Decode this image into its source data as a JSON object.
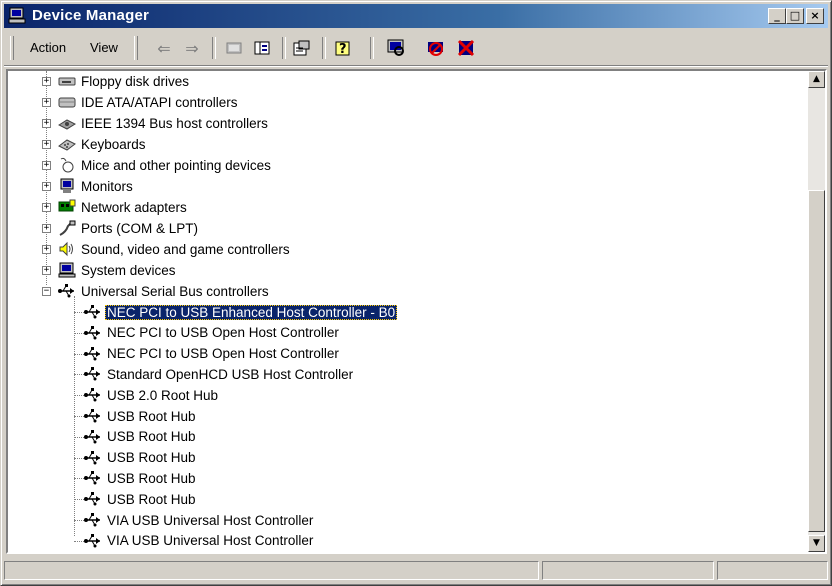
{
  "window": {
    "title": "Device Manager"
  },
  "menu": [
    {
      "label": "Action",
      "underline": "A"
    },
    {
      "label": "View",
      "underline": "V"
    }
  ],
  "toolbar": [
    "back-icon",
    "forward-icon",
    "up-icon",
    "show-hide-tree-icon",
    "properties-icon",
    "help-icon",
    "scan-hardware-icon",
    "disable-device-icon",
    "uninstall-device-icon"
  ],
  "tree": {
    "categories": [
      {
        "label": "Floppy disk drives",
        "icon": "floppy-drive-icon"
      },
      {
        "label": "IDE ATA/ATAPI controllers",
        "icon": "ide-controller-icon"
      },
      {
        "label": "IEEE 1394 Bus host controllers",
        "icon": "ieee1394-icon"
      },
      {
        "label": "Keyboards",
        "icon": "keyboard-icon"
      },
      {
        "label": "Mice and other pointing devices",
        "icon": "mouse-icon"
      },
      {
        "label": "Monitors",
        "icon": "monitor-icon"
      },
      {
        "label": "Network adapters",
        "icon": "network-adapter-icon"
      },
      {
        "label": "Ports (COM & LPT)",
        "icon": "port-icon"
      },
      {
        "label": "Sound, video and game controllers",
        "icon": "sound-icon"
      },
      {
        "label": "System devices",
        "icon": "system-device-icon"
      },
      {
        "label": "Universal Serial Bus controllers",
        "icon": "usb-icon"
      }
    ],
    "usb_children": [
      "NEC PCI to USB Enhanced Host Controller - B0",
      "NEC PCI to USB Open Host Controller",
      "NEC PCI to USB Open Host Controller",
      "Standard OpenHCD USB Host Controller",
      "USB 2.0 Root Hub",
      "USB Root Hub",
      "USB Root Hub",
      "USB Root Hub",
      "USB Root Hub",
      "USB Root Hub",
      "VIA USB Universal Host Controller",
      "VIA USB Universal Host Controller"
    ],
    "selected": "NEC PCI to USB Enhanced Host Controller - B0"
  },
  "colors": {
    "titlebar": "#0a246a",
    "selection": "#0a246a",
    "face": "#d4d0c8"
  }
}
